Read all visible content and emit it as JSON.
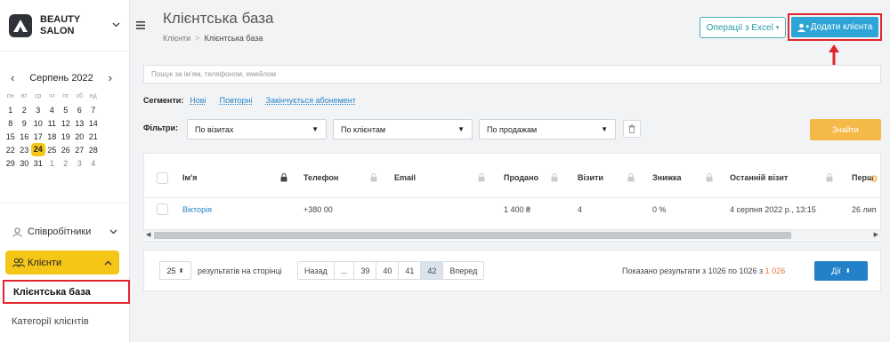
{
  "brand": {
    "line1": "BEAUTY",
    "line2": "SALON"
  },
  "calendar": {
    "month_label": "Серпень 2022",
    "prev": "‹",
    "next": "›",
    "weekdays": [
      "пн",
      "вт",
      "ср",
      "чт",
      "пт",
      "сб",
      "нд"
    ],
    "weeks": [
      [
        "1",
        "2",
        "3",
        "4",
        "5",
        "6",
        "7"
      ],
      [
        "8",
        "9",
        "10",
        "11",
        "12",
        "13",
        "14"
      ],
      [
        "15",
        "16",
        "17",
        "18",
        "19",
        "20",
        "21"
      ],
      [
        "22",
        "23",
        "24",
        "25",
        "26",
        "27",
        "28"
      ],
      [
        "29",
        "30",
        "31",
        "1",
        "2",
        "3",
        "4"
      ]
    ],
    "today": "24",
    "accent": "#f5c518"
  },
  "sidebar": {
    "staff_label": "Співробітники",
    "clients_label": "Клієнти",
    "sub_active": "Клієнтська база",
    "sub_other": "Категорії клієнтів"
  },
  "header": {
    "title": "Клієнтська база",
    "breadcrumb": [
      "Клієнти",
      "Клієнтська база"
    ],
    "breadcrumb_sep": ">",
    "excel_button": "Операції з Excel",
    "add_button": "Додати клієнта",
    "add_color": "#2fa5d7"
  },
  "search": {
    "placeholder": "Пошук за ім'ям, телефоном, емейлом"
  },
  "segments": {
    "label": "Сегменти:",
    "items": [
      "Нові",
      "Повторні",
      "Закінчується абонемент"
    ]
  },
  "filters": {
    "label": "Фільтри:",
    "visits": "По візитах",
    "clients": "По клієнтам",
    "sales": "По продажам",
    "find_button": "Знайти"
  },
  "table": {
    "columns": [
      "Ім'я",
      "Телефон",
      "Email",
      "Продано",
      "Візити",
      "Знижка",
      "Останній візит",
      "Перш"
    ],
    "row": {
      "name": "Вікторія",
      "phone": "+380 00",
      "email": "",
      "sold": "1 400 ₴",
      "visits": "4",
      "discount": "0 %",
      "last_visit": "4 серпня 2022 р., 13:15",
      "first": "26 лип"
    }
  },
  "pagination": {
    "per_page": "25",
    "per_page_label": "результатів на сторінці",
    "prev": "Назад",
    "ellipsis": "...",
    "pages": [
      "39",
      "40",
      "41",
      "42"
    ],
    "active_page": "42",
    "next": "Вперед",
    "results_text": "Показано результати з 1026 по 1026 з",
    "results_total": "1 026",
    "actions_button": "Дії"
  }
}
